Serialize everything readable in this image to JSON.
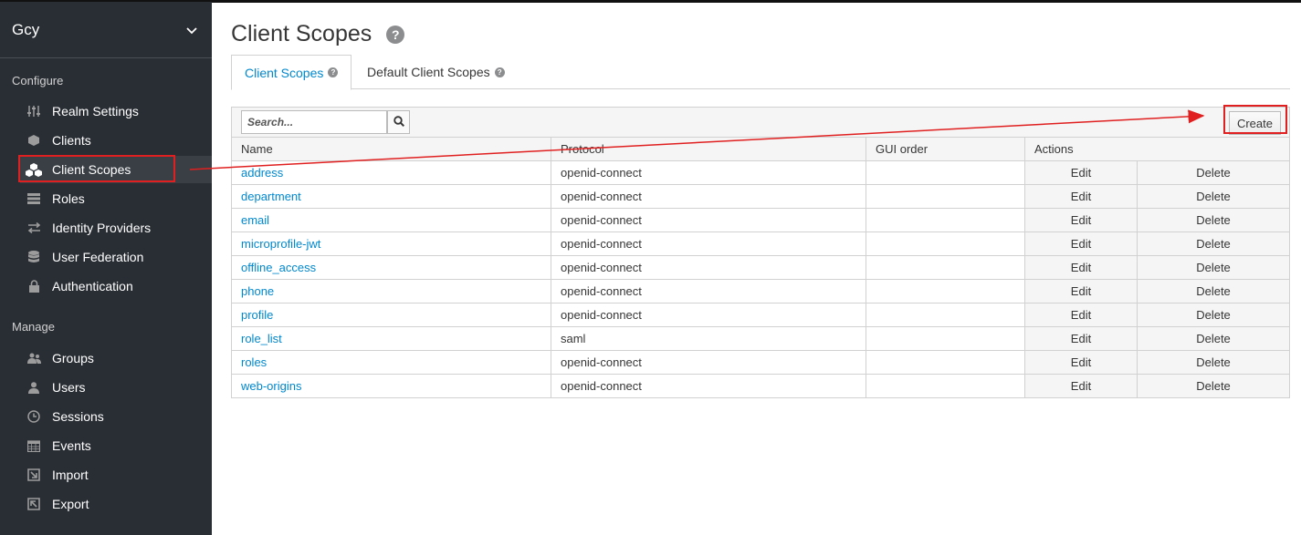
{
  "sidebar": {
    "realm": "Gcy",
    "configure_label": "Configure",
    "manage_label": "Manage",
    "configure_items": [
      {
        "label": "Realm Settings",
        "icon": "sliders-icon"
      },
      {
        "label": "Clients",
        "icon": "cube-icon"
      },
      {
        "label": "Client Scopes",
        "icon": "cubes-icon"
      },
      {
        "label": "Roles",
        "icon": "list-icon"
      },
      {
        "label": "Identity Providers",
        "icon": "exchange-icon"
      },
      {
        "label": "User Federation",
        "icon": "database-icon"
      },
      {
        "label": "Authentication",
        "icon": "lock-icon"
      }
    ],
    "manage_items": [
      {
        "label": "Groups",
        "icon": "users-icon"
      },
      {
        "label": "Users",
        "icon": "user-icon"
      },
      {
        "label": "Sessions",
        "icon": "clock-icon"
      },
      {
        "label": "Events",
        "icon": "calendar-icon"
      },
      {
        "label": "Import",
        "icon": "import-icon"
      },
      {
        "label": "Export",
        "icon": "export-icon"
      }
    ]
  },
  "main": {
    "title": "Client Scopes",
    "tabs": [
      {
        "label": "Client Scopes"
      },
      {
        "label": "Default Client Scopes"
      }
    ],
    "search_placeholder": "Search...",
    "create_label": "Create",
    "columns": [
      "Name",
      "Protocol",
      "GUI order",
      "Actions"
    ],
    "edit_label": "Edit",
    "delete_label": "Delete",
    "rows": [
      {
        "name": "address",
        "protocol": "openid-connect",
        "gui_order": ""
      },
      {
        "name": "department",
        "protocol": "openid-connect",
        "gui_order": ""
      },
      {
        "name": "email",
        "protocol": "openid-connect",
        "gui_order": ""
      },
      {
        "name": "microprofile-jwt",
        "protocol": "openid-connect",
        "gui_order": ""
      },
      {
        "name": "offline_access",
        "protocol": "openid-connect",
        "gui_order": ""
      },
      {
        "name": "phone",
        "protocol": "openid-connect",
        "gui_order": ""
      },
      {
        "name": "profile",
        "protocol": "openid-connect",
        "gui_order": ""
      },
      {
        "name": "role_list",
        "protocol": "saml",
        "gui_order": ""
      },
      {
        "name": "roles",
        "protocol": "openid-connect",
        "gui_order": ""
      },
      {
        "name": "web-origins",
        "protocol": "openid-connect",
        "gui_order": ""
      }
    ]
  },
  "colors": {
    "sidebar_bg": "#292e34",
    "link": "#0088ce",
    "annotation": "#e02020"
  }
}
